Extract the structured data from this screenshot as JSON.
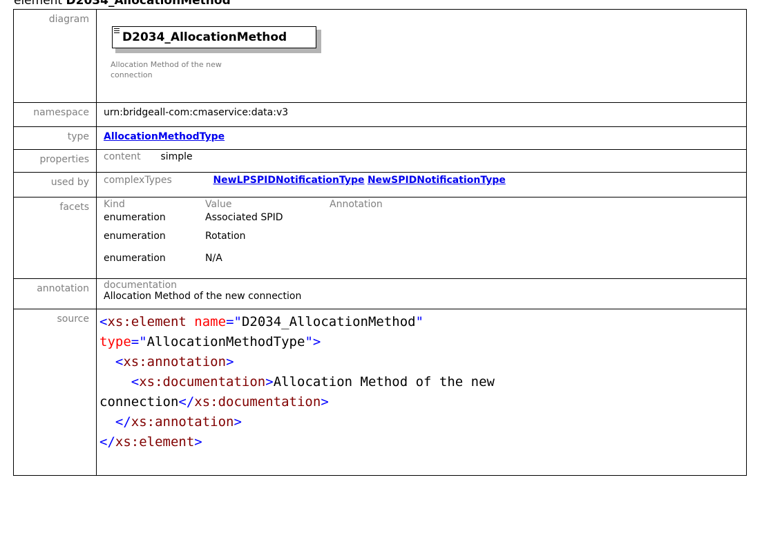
{
  "title": {
    "prefix": "element",
    "name": "D2034_AllocationMethod"
  },
  "labels": {
    "diagram": "diagram",
    "namespace": "namespace",
    "type": "type",
    "properties": "properties",
    "used_by": "used by",
    "facets": "facets",
    "annotation": "annotation",
    "source": "source"
  },
  "diagram": {
    "element_name": "D2034_AllocationMethod",
    "documentation": "Allocation Method of the new connection",
    "icon": "element-lines-icon"
  },
  "namespace": "urn:bridgeall-com:cmaservice:data:v3",
  "type": "AllocationMethodType",
  "properties": {
    "key": "content",
    "value": "simple"
  },
  "used_by": {
    "category": "complexTypes",
    "items": [
      "NewLPSPIDNotificationType",
      "NewSPIDNotificationType"
    ]
  },
  "facets": {
    "headers": [
      "Kind",
      "Value",
      "Annotation"
    ],
    "rows": [
      {
        "kind": "enumeration",
        "value": "Associated SPID"
      },
      {
        "kind": "enumeration",
        "value": "Rotation"
      },
      {
        "kind": "enumeration",
        "value": "N/A"
      }
    ]
  },
  "annotation": {
    "key": "documentation",
    "text": "Allocation Method of the new connection"
  },
  "source": {
    "line1_open": "<",
    "line1_tag": "xs:element",
    "line1_attr1": "name",
    "line1_eq": "=\"",
    "line1_val1": "D2034_AllocationMethod",
    "line1_q": "\"",
    "line2_attr": "type",
    "line2_eq": "=\"",
    "line2_val": "AllocationMethodType",
    "line2_close": "\">",
    "line3_open": "<",
    "line3_tag": "xs:annotation",
    "line3_close": ">",
    "line4_open": "<",
    "line4_tag": "xs:documentation",
    "line4_close": ">",
    "line4_text": "Allocation Method of the new",
    "line5_text": "connection",
    "line5_open": "</",
    "line5_tag": "xs:documentation",
    "line5_close": ">",
    "line6_open": "</",
    "line6_tag": "xs:annotation",
    "line6_close": ">",
    "line7_open": "</",
    "line7_tag": "xs:element",
    "line7_close": ">"
  }
}
